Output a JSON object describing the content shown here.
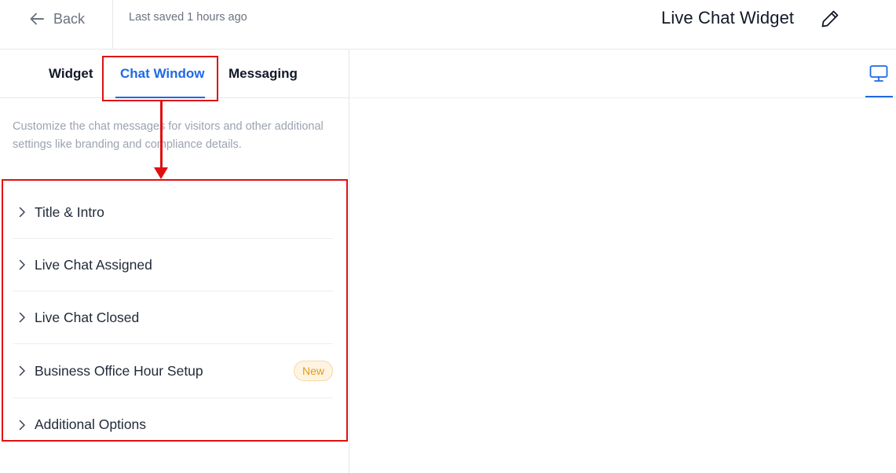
{
  "header": {
    "back_label": "Back",
    "saved_text": "Last saved 1 hours ago",
    "title": "Live Chat Widget"
  },
  "tabs": [
    {
      "label": "Widget",
      "active": false
    },
    {
      "label": "Chat Window",
      "active": true
    },
    {
      "label": "Messaging",
      "active": false
    }
  ],
  "description": "Customize the chat messages for visitors and other additional settings like branding and compliance details.",
  "accordion": [
    {
      "label": "Title & Intro"
    },
    {
      "label": "Live Chat Assigned"
    },
    {
      "label": "Live Chat Closed"
    },
    {
      "label": "Business Office Hour Setup",
      "badge": "New"
    },
    {
      "label": "Additional Options"
    }
  ],
  "icons": {
    "back": "arrow-left-icon",
    "edit": "pencil-icon",
    "chevron": "chevron-right-icon",
    "preview_device": "desktop-icon"
  },
  "colors": {
    "accent": "#1d6ae5",
    "annotation": "#e01010",
    "badge_text": "#e69a1c",
    "badge_bg": "#fef4e1"
  }
}
